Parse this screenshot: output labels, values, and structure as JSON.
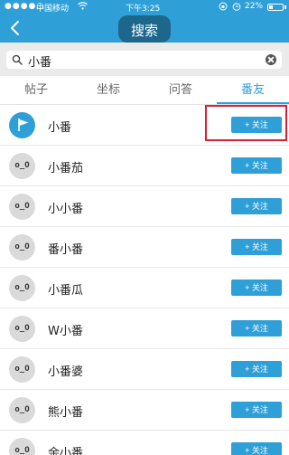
{
  "status_bar": {
    "signal_dots": "●●●●○",
    "carrier": "中国移动",
    "wifi_icon": "wifi-icon",
    "time": "下午3:25",
    "lock_icon": "lock-rotation-icon",
    "alarm_icon": "alarm-clock-icon",
    "battery_text": "22%",
    "battery_level": 0.22
  },
  "nav": {
    "title": "搜索",
    "back_icon": "chevron-left-icon"
  },
  "search": {
    "value": "小番",
    "search_icon": "magnifier-icon",
    "clear_icon": "clear-circle-icon"
  },
  "tabs": [
    {
      "label": "帖子",
      "active": false
    },
    {
      "label": "坐标",
      "active": false
    },
    {
      "label": "问答",
      "active": false
    },
    {
      "label": "番友",
      "active": true
    }
  ],
  "results": [
    {
      "name": "小番",
      "avatar": "flag-avatar",
      "avatar_text": "",
      "follow_label": "+ 关注"
    },
    {
      "name": "小番茄",
      "avatar": "default",
      "avatar_text": "o_O",
      "follow_label": "+ 关注"
    },
    {
      "name": "小小番",
      "avatar": "default",
      "avatar_text": "o_O",
      "follow_label": "+ 关注"
    },
    {
      "name": "番小番",
      "avatar": "default",
      "avatar_text": "o_O",
      "follow_label": "+ 关注"
    },
    {
      "name": "小番瓜",
      "avatar": "default",
      "avatar_text": "o_O",
      "follow_label": "+ 关注"
    },
    {
      "name": "W小番",
      "avatar": "default",
      "avatar_text": "o_O",
      "follow_label": "+ 关注"
    },
    {
      "name": "小番婆",
      "avatar": "default",
      "avatar_text": "o_O",
      "follow_label": "+ 关注"
    },
    {
      "name": "熊小番",
      "avatar": "default",
      "avatar_text": "o_O",
      "follow_label": "+ 关注"
    },
    {
      "name": "余小番",
      "avatar": "default",
      "avatar_text": "o_O",
      "follow_label": "+ 关注"
    }
  ],
  "colors": {
    "accent": "#2f9fd8",
    "highlight_box": "#d91f3a"
  }
}
